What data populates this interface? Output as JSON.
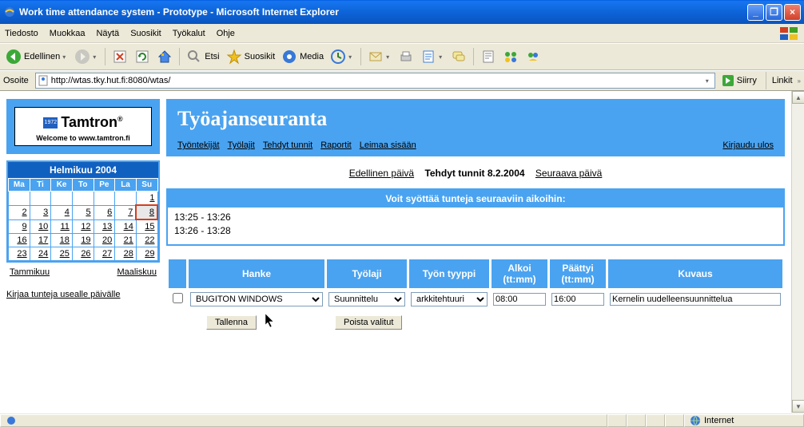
{
  "window": {
    "title": "Work time attendance system - Prototype - Microsoft Internet Explorer"
  },
  "menu": {
    "items": [
      "Tiedosto",
      "Muokkaa",
      "Näytä",
      "Suosikit",
      "Työkalut",
      "Ohje"
    ]
  },
  "toolbar": {
    "back": "Edellinen",
    "search": "Etsi",
    "favorites": "Suosikit",
    "media": "Media"
  },
  "address": {
    "label": "Osoite",
    "url": "http://wtas.tky.hut.fi:8080/wtas/",
    "go": "Siirry",
    "links": "Linkit"
  },
  "logo": {
    "year": "1972",
    "brand": "Tamtron",
    "welcome": "Welcome to www.tamtron.fi"
  },
  "calendar": {
    "title": "Helmikuu  2004",
    "dows": [
      "Ma",
      "Ti",
      "Ke",
      "To",
      "Pe",
      "La",
      "Su"
    ],
    "weeks": [
      [
        "",
        "",
        "",
        "",
        "",
        "",
        "1"
      ],
      [
        "2",
        "3",
        "4",
        "5",
        "6",
        "7",
        "8"
      ],
      [
        "9",
        "10",
        "11",
        "12",
        "13",
        "14",
        "15"
      ],
      [
        "16",
        "17",
        "18",
        "19",
        "20",
        "21",
        "22"
      ],
      [
        "23",
        "24",
        "25",
        "26",
        "27",
        "28",
        "29"
      ]
    ],
    "today": "8",
    "prev": "Tammikuu",
    "next": "Maaliskuu"
  },
  "sidebar": {
    "multi_link": "Kirjaa tunteja usealle päivälle"
  },
  "header": {
    "title": "Työajanseuranta",
    "nav": [
      "Työntekijät",
      "Työlajit",
      "Tehdyt tunnit",
      "Raportit",
      "Leimaa sisään"
    ],
    "logout": "Kirjaudu ulos"
  },
  "datebar": {
    "prev": "Edellinen päivä",
    "title": "Tehdyt tunnit 8.2.2004",
    "next": "Seuraava päivä"
  },
  "timebox": {
    "heading": "Voit syöttää tunteja seuraaviin aikoihin:",
    "lines": [
      "13:25 - 13:26",
      "13:26 - 13:28"
    ]
  },
  "table": {
    "headers": {
      "hanke": "Hanke",
      "tyolaji": "Työlaji",
      "tyyppi": "Työn tyyppi",
      "alkoi": "Alkoi (tt:mm)",
      "paattyi": "Päättyi (tt:mm)",
      "kuvaus": "Kuvaus"
    },
    "row": {
      "hanke": "BUGITON WINDOWS",
      "tyolaji": "Suunnittelu",
      "tyyppi": "arkkitehtuuri",
      "alkoi": "08:00",
      "paattyi": "16:00",
      "kuvaus": "Kernelin uudelleensuunnittelua"
    },
    "save": "Tallenna",
    "delete": "Poista valitut"
  },
  "status": {
    "zone": "Internet"
  }
}
